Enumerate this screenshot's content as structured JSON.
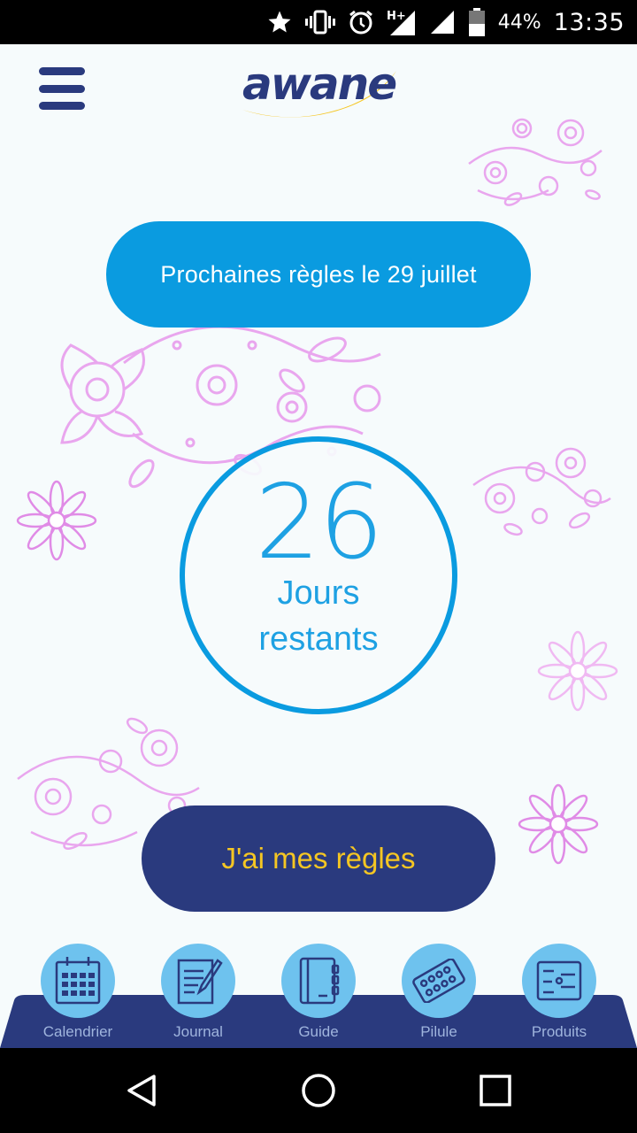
{
  "status_bar": {
    "battery_percent": "44%",
    "time": "13:35",
    "icons": [
      "star-icon",
      "vibrate-icon",
      "alarm-icon",
      "hplus-signal-icon",
      "signal-icon",
      "battery-icon"
    ]
  },
  "header": {
    "menu_icon": "hamburger-menu-icon",
    "logo_text": "awane"
  },
  "next_period": {
    "label": "Prochaines règles le 29 juillet"
  },
  "counter": {
    "days": "26",
    "label_line1": "Jours",
    "label_line2": "restants"
  },
  "action": {
    "label": "J'ai mes règles"
  },
  "bottom_nav": {
    "items": [
      {
        "label": "Calendrier",
        "icon": "calendar-icon"
      },
      {
        "label": "Journal",
        "icon": "journal-icon"
      },
      {
        "label": "Guide",
        "icon": "guide-book-icon"
      },
      {
        "label": "Pilule",
        "icon": "pill-pack-icon"
      },
      {
        "label": "Produits",
        "icon": "products-icon"
      }
    ]
  },
  "android_nav": {
    "icons": [
      "back-icon",
      "home-icon",
      "recents-icon"
    ]
  },
  "colors": {
    "background": "#f6fbfc",
    "primary_blue": "#0a9be0",
    "navy": "#2a3a7e",
    "accent_yellow": "#f5c623",
    "nav_bubble": "#6ec2ee",
    "flower_pink": "#e9a6ee"
  }
}
